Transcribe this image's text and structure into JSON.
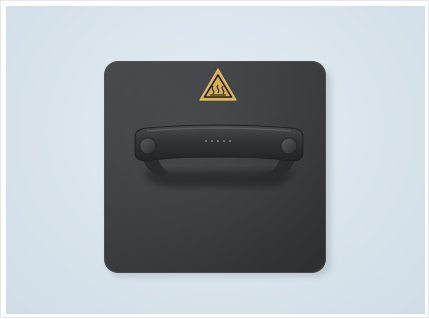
{
  "image": {
    "subject": "dark-gray-heat-plate-with-handle",
    "colors": {
      "background": "#d9e4ec",
      "plate": "#3a3b3e",
      "handle": "#2f3033",
      "warning_label": "#d8ad4a"
    },
    "icons": [
      "hot-surface-warning-icon"
    ]
  }
}
